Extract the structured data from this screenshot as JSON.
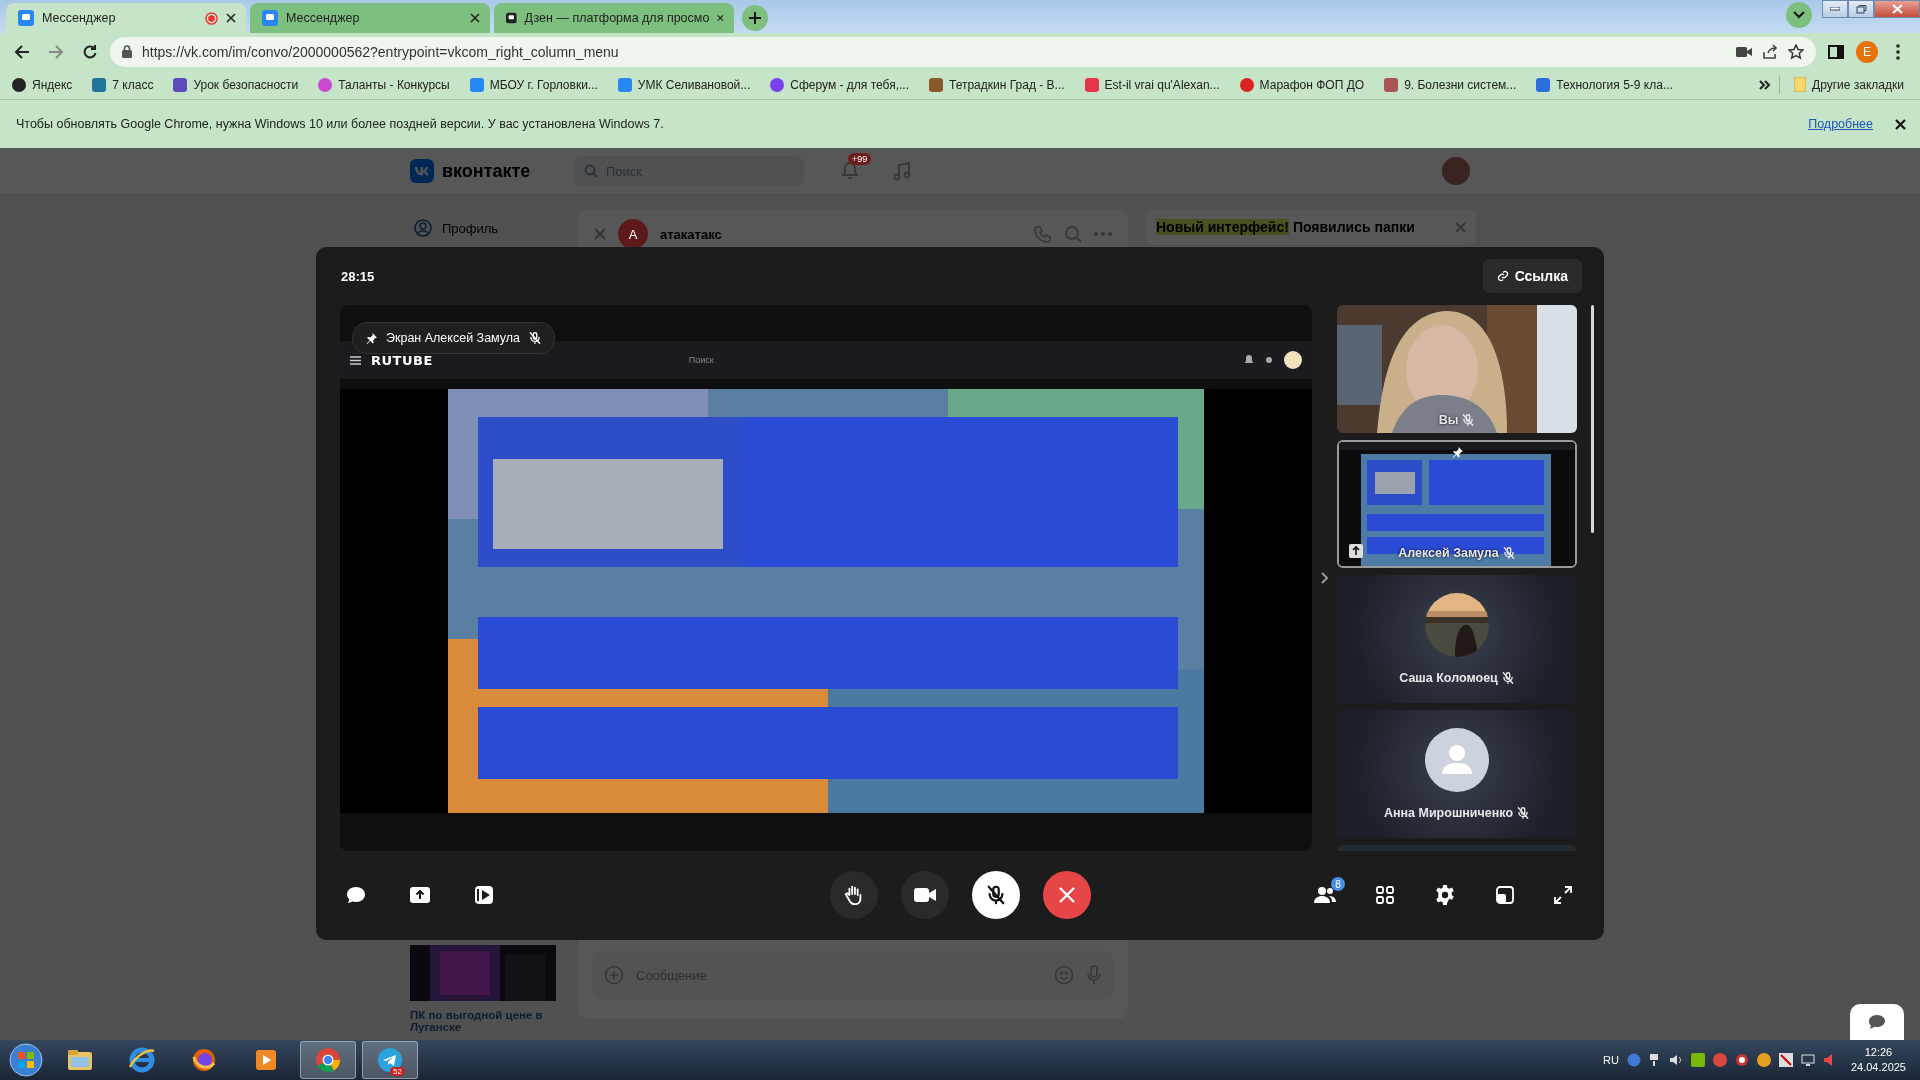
{
  "browser": {
    "tabs": [
      {
        "title": "Мессенджер",
        "selected": true,
        "recording": true
      },
      {
        "title": "Мессенджер",
        "selected": false,
        "recording": false
      },
      {
        "title": "Дзен — платформа для просмо",
        "selected": false,
        "recording": false
      }
    ],
    "url": "https://vk.com/im/convo/2000000562?entrypoint=vkcom_right_column_menu",
    "profile_initial": "E",
    "bookmarks": [
      "Яндекс",
      "7 класс",
      "Урок безопасности",
      "Таланты - Конкурсы",
      "МБОУ г. Горловки...",
      "УМК Селивановой...",
      "Сферум - для тебя,...",
      "Тетрадкин Град - В...",
      "Est-il vrai qu'Alexan...",
      "Марафон ФОП ДО",
      "9. Болезни систем...",
      "Технология 5-9 кла..."
    ],
    "other_bookmarks": "Другие закладки",
    "infobar": {
      "message": "Чтобы обновлять Google Chrome, нужна Windows 10 или более поздней версии. У вас установлена Windows 7.",
      "link": "Подробнее"
    }
  },
  "vk": {
    "logo": "вконтакте",
    "search_placeholder": "Поиск",
    "notifications_badge": "+99",
    "menu": [
      "Профиль"
    ],
    "chat_title": "атакатакс",
    "chat_avatar": "А",
    "banner_highlight": "Новый интерфейс!",
    "banner_text": "Появились папки",
    "ad_caption": "ПК по выгодной цене в Луганске",
    "message_placeholder": "Сообщение"
  },
  "call": {
    "timer": "28:15",
    "link_button": "Ссылка",
    "screen_label": "Экран Алексей Замула",
    "presenter_muted": true,
    "shared_screen": {
      "logo": "RUTUBE",
      "search_placeholder": "Поиск"
    },
    "participants": [
      {
        "name": "Вы",
        "kind": "video",
        "muted": true,
        "selected": false
      },
      {
        "name": "Алексей Замула",
        "kind": "screen",
        "muted": true,
        "selected": true
      },
      {
        "name": "Саша Коломоец",
        "muted": true,
        "selected": false
      },
      {
        "name": "Анна Мирошниченко",
        "kind": "default",
        "muted": true,
        "selected": false
      }
    ],
    "participants_count": "8",
    "mic_muted": true
  },
  "taskbar": {
    "telegram_badge": "52",
    "language": "RU",
    "time": "12:26",
    "date": "24.04.2025"
  }
}
